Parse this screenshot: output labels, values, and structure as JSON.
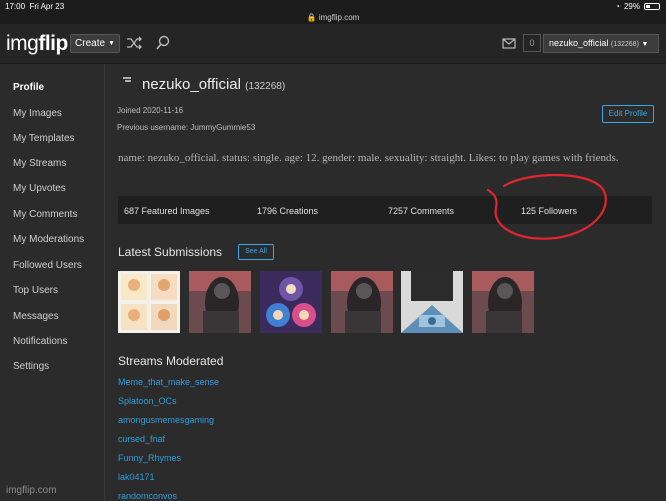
{
  "status_bar": {
    "time": "17:00",
    "date": "Fri Apr 23",
    "battery": "29%"
  },
  "browser": {
    "url": "imgflip.com"
  },
  "header": {
    "logo_main": "img",
    "logo_flip": "flip",
    "create_label": "Create",
    "notif_count": "0",
    "username": "nezuko_official",
    "points": "(132268)"
  },
  "sidebar": {
    "items": [
      "Profile",
      "My Images",
      "My Templates",
      "My Streams",
      "My Upvotes",
      "My Comments",
      "My Moderations",
      "Followed Users",
      "Top Users",
      "Messages",
      "Notifications",
      "Settings"
    ],
    "footer": "imgflip.com"
  },
  "profile": {
    "username": "nezuko_official",
    "points": "(132268)",
    "joined": "Joined 2020-11-16",
    "previous_username": "Previous username: JummyGummie53",
    "edit_label": "Edit Profile",
    "bio": "name: nezuko_official. status: single. age: 12. gender: male. sexuality: straight. Likes: to play games with friends."
  },
  "stats": {
    "featured": "687 Featured Images",
    "creations": "1796 Creations",
    "comments": "7257 Comments",
    "followers": "125 Followers"
  },
  "latest": {
    "title": "Latest Submissions",
    "see_all": "See All"
  },
  "streams": {
    "title": "Streams Moderated",
    "items": [
      "Meme_that_make_sense",
      "Splatoon_OCs",
      "amongusmemesgaming",
      "cursed_fnaf",
      "Funny_Rhymes",
      "lak04171",
      "randomconvos"
    ]
  },
  "colors": {
    "accent": "#3ba7e3",
    "link": "#2d9fe0",
    "annotation": "#e0262f"
  }
}
